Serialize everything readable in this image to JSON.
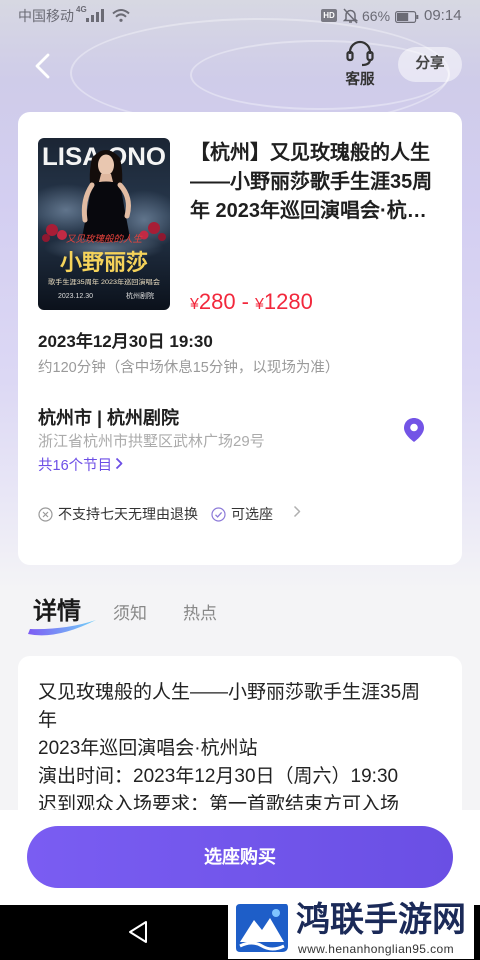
{
  "status_bar": {
    "carrier": "中国移动",
    "network_type": "4G",
    "hd_badge": "HD",
    "battery_percent": "66%",
    "battery_level": 0.66,
    "time": "09:14",
    "icons": [
      "signal-icon",
      "wifi-icon",
      "mute-icon",
      "battery-icon"
    ]
  },
  "header": {
    "back_icon": "chevron-left-icon",
    "service_icon": "headset-icon",
    "service_label": "客服",
    "share_label": "分享"
  },
  "event": {
    "poster": {
      "artist_en": "LISA ONO",
      "subtitle": "又见玫瑰般的人生",
      "artist_cn": "小野丽莎",
      "tagline": "歌手生涯35周年 2023年巡回演唱会",
      "date": "2023.12.30",
      "venue": "杭州剧院"
    },
    "title": "【杭州】又见玫瑰般的人生——小野丽莎歌手生涯35周年 2023年巡回演唱会·杭…",
    "price": {
      "currency": "¥",
      "min": "280",
      "separator": "-",
      "max": "1280"
    },
    "datetime": "2023年12月30日 19:30",
    "duration": "约120分钟（含中场休息15分钟，以现场为准）",
    "venue": "杭州市 | 杭州剧院",
    "address": "浙江省杭州市拱墅区武林广场29号",
    "location_icon": "location-pin-icon",
    "program_link": "共16个节目",
    "tags": [
      {
        "icon": "circle-x-icon",
        "text": "不支持七天无理由退换"
      },
      {
        "icon": "circle-check-icon",
        "text": "可选座"
      }
    ]
  },
  "tabs": {
    "active": 0,
    "items": [
      {
        "label": "详情"
      },
      {
        "label": "须知"
      },
      {
        "label": "热点"
      }
    ]
  },
  "details": {
    "lines": [
      "又见玫瑰般的人生——小野丽莎歌手生涯35周年",
      "2023年巡回演唱会·杭州站",
      "演出时间：2023年12月30日（周六）19:30",
      "迟到观众入场要求：第一首歌结束方可入场"
    ]
  },
  "footer": {
    "buy_label": "选座购买"
  },
  "nav_bar": {
    "icons": [
      "back-triangle-icon"
    ]
  },
  "watermark": {
    "name": "鸿联手游网",
    "url": "www.henanhonglian95.com"
  },
  "colors": {
    "accent": "#6c4ee6",
    "price": "#f2283c",
    "page_background": "#f4f4f6"
  }
}
